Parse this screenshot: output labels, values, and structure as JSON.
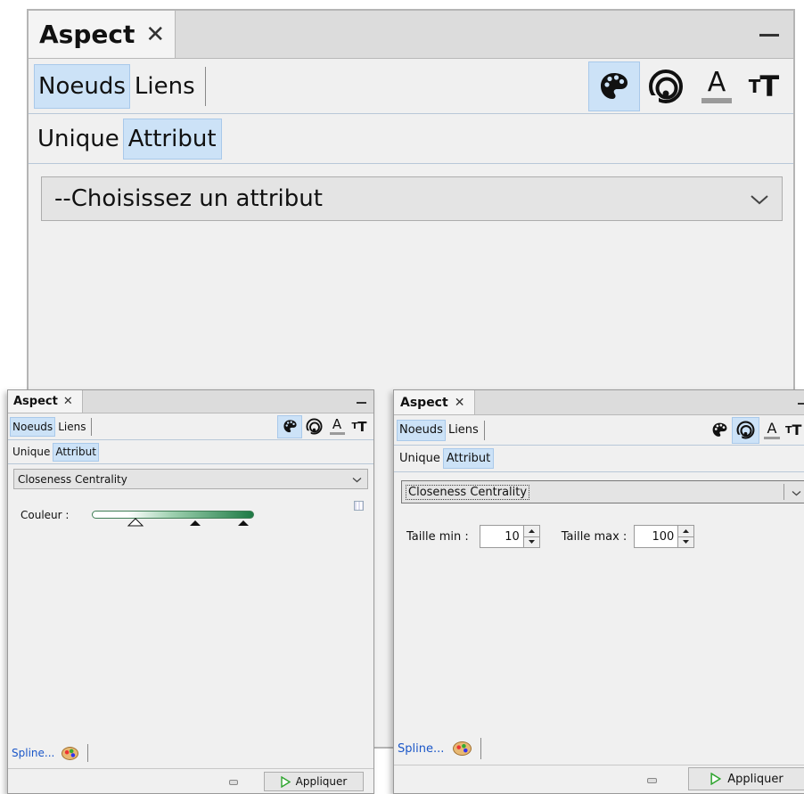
{
  "panel_main": {
    "tab_title": "Aspect",
    "close_glyph": "✕",
    "tabs": {
      "nodes": "Noeuds",
      "links": "Liens"
    },
    "modes": {
      "unique": "Unique",
      "attribute": "Attribut"
    },
    "attribute_combo": "--Choisissez un attribut",
    "active_icon": "color-palette-icon"
  },
  "panel_color": {
    "tab_title": "Aspect",
    "close_glyph": "✕",
    "tabs": {
      "nodes": "Noeuds",
      "links": "Liens"
    },
    "modes": {
      "unique": "Unique",
      "attribute": "Attribut"
    },
    "attribute_combo": "Closeness Centrality",
    "color_label": "Couleur :",
    "gradient": {
      "start": "#ffffff",
      "end": "#1e7a45"
    },
    "spline_link": "Spline...",
    "apply_button": "Appliquer",
    "active_icon": "color-palette-icon"
  },
  "panel_size": {
    "tab_title": "Aspect",
    "close_glyph": "✕",
    "tabs": {
      "nodes": "Noeuds",
      "links": "Liens"
    },
    "modes": {
      "unique": "Unique",
      "attribute": "Attribut"
    },
    "attribute_combo": "Closeness Centrality",
    "min_label": "Taille min :",
    "min_value": "10",
    "max_label": "Taille max :",
    "max_value": "100",
    "spline_link": "Spline...",
    "apply_button": "Appliquer",
    "active_icon": "size-icon"
  },
  "icons": [
    "color-palette-icon",
    "size-icon",
    "label-color-icon",
    "label-size-icon",
    "close-icon",
    "minimize-icon",
    "chevron-down-icon",
    "play-icon",
    "keyboard-icon",
    "palette-icon"
  ],
  "colors": {
    "selected": "#cce2f7",
    "selected_border": "#a9c9ea",
    "link": "#1a56c8",
    "apply_arrow": "#2fa52f"
  }
}
